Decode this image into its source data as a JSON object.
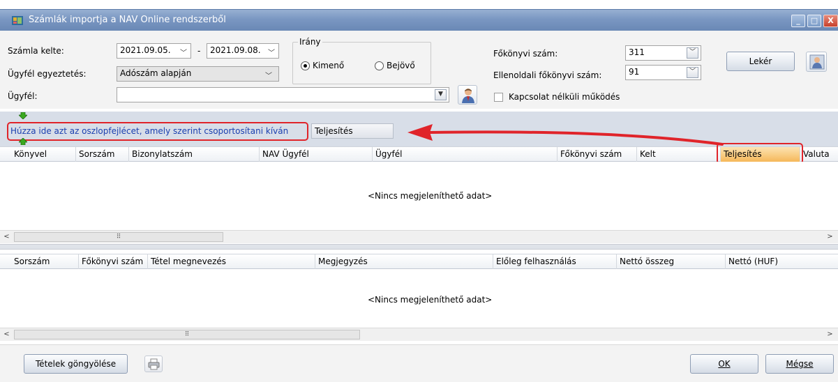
{
  "window": {
    "title": "Számlák importja a NAV Online rendszerből",
    "controls": [
      "minimize",
      "maximize",
      "close"
    ]
  },
  "form": {
    "szamla_kelte_label": "Számla kelte:",
    "date_from": "2021.09.05.",
    "date_separator": "-",
    "date_to": "2021.09.08.",
    "ugyfel_egyeztetes_label": "Ügyfél egyeztetés:",
    "ugyfel_egyeztetes_value": "Adószám alapján",
    "ugyfel_label": "Ügyfél:",
    "ugyfel_value": "",
    "irany_label": "Irány",
    "radio_kimeno": "Kimenő",
    "radio_bejovo": "Bejövő",
    "radio_selected": "Kimenő",
    "fokonyvi_szam_label": "Főkönyvi szám:",
    "fokonyvi_szam_value": "311",
    "ellenoldali_label": "Ellenoldali főkönyvi szám:",
    "ellenoldali_value": "91",
    "kapcsolat_label": "Kapcsolat nélküli működés",
    "kapcsolat_checked": false,
    "leker_button": "Lekér"
  },
  "group_panel": {
    "hint": "Húzza ide azt az oszlopfejlécet, amely szerint csoportosítani kíván",
    "dragged_column": "Teljesítés"
  },
  "top_grid": {
    "columns": [
      "Könyvel",
      "Sorszám",
      "Bizonylatszám",
      "NAV Ügyfél",
      "Ügyfél",
      "Főkönyvi szám",
      "Kelt",
      "Teljesítés",
      "Valuta"
    ],
    "highlighted_column": "Teljesítés",
    "empty_text": "<Nincs megjeleníthető adat>",
    "scroll_thumb": "⠿"
  },
  "bottom_grid": {
    "columns": [
      "Sorszám",
      "Főkönyvi szám",
      "Tétel megnevezés",
      "Megjegyzés",
      "Előleg felhasználás",
      "Nettó összeg",
      "Nettó (HUF)"
    ],
    "empty_text": "<Nincs megjeleníthető adat>",
    "scroll_thumb": "⠿"
  },
  "footer": {
    "tetelek_button": "Tételek göngyölése",
    "ok_button": "OK",
    "megse_button": "Mégse"
  },
  "colors": {
    "title_bar": "#7a97c2",
    "annotation_red": "#e0242a",
    "highlight_orange": "#f5b85a",
    "drop_arrow_green": "#3aa820"
  },
  "icons": [
    "app-icon",
    "user-icon",
    "printer-icon",
    "drop-arrow-down-icon",
    "drop-arrow-up-icon"
  ]
}
